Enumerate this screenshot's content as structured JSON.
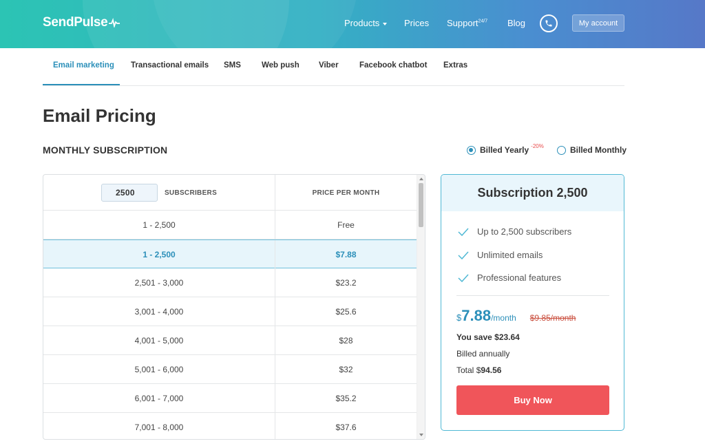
{
  "header": {
    "logo": "SendPulse",
    "nav": {
      "products": "Products",
      "prices": "Prices",
      "support": "Support",
      "support_sup": "24/7",
      "blog": "Blog"
    },
    "account_button": "My account",
    "icons": {
      "logo_mark": "pulse-icon",
      "phone": "phone-icon",
      "caret": "caret-down-icon"
    }
  },
  "tabs": [
    {
      "label": "Email marketing",
      "active": true
    },
    {
      "label": "Transactional emails"
    },
    {
      "label": "SMS"
    },
    {
      "label": "Web push"
    },
    {
      "label": "Viber"
    },
    {
      "label": "Facebook chatbot"
    },
    {
      "label": "Extras"
    }
  ],
  "page_title": "Email Pricing",
  "section_title": "MONTHLY SUBSCRIPTION",
  "billing": {
    "yearly_label": "Billed Yearly",
    "yearly_discount": "-20%",
    "monthly_label": "Billed Monthly",
    "selected": "yearly"
  },
  "table": {
    "subscriber_input_value": "2500",
    "col1_header": "SUBSCRIBERS",
    "col2_header": "PRICE PER MONTH",
    "rows": [
      {
        "range": "1 - 2,500",
        "price": "Free"
      },
      {
        "range": "1 - 2,500",
        "price": "$7.88",
        "selected": true
      },
      {
        "range": "2,501 - 3,000",
        "price": "$23.2"
      },
      {
        "range": "3,001 - 4,000",
        "price": "$25.6"
      },
      {
        "range": "4,001 - 5,000",
        "price": "$28"
      },
      {
        "range": "5,001 - 6,000",
        "price": "$32"
      },
      {
        "range": "6,001 - 7,000",
        "price": "$35.2"
      },
      {
        "range": "7,001 - 8,000",
        "price": "$37.6"
      }
    ]
  },
  "card": {
    "title": "Subscription 2,500",
    "features": [
      "Up to 2,500 subscribers",
      "Unlimited emails",
      "Professional features"
    ],
    "price_currency": "$",
    "price_value": "7.88",
    "price_unit": "/month",
    "old_price": "$9.85/month",
    "you_save_label": "You save",
    "you_save_value": "$23.64",
    "billed": "Billed annually",
    "total_label": "Total",
    "total_currency": "$",
    "total_value": "94.56",
    "buy_button": "Buy Now"
  },
  "colors": {
    "accent": "#2b8fb9",
    "buy": "#f0555a",
    "header_start": "#2cc4b4",
    "header_end": "#5678c8",
    "discount": "#e84c4c"
  }
}
